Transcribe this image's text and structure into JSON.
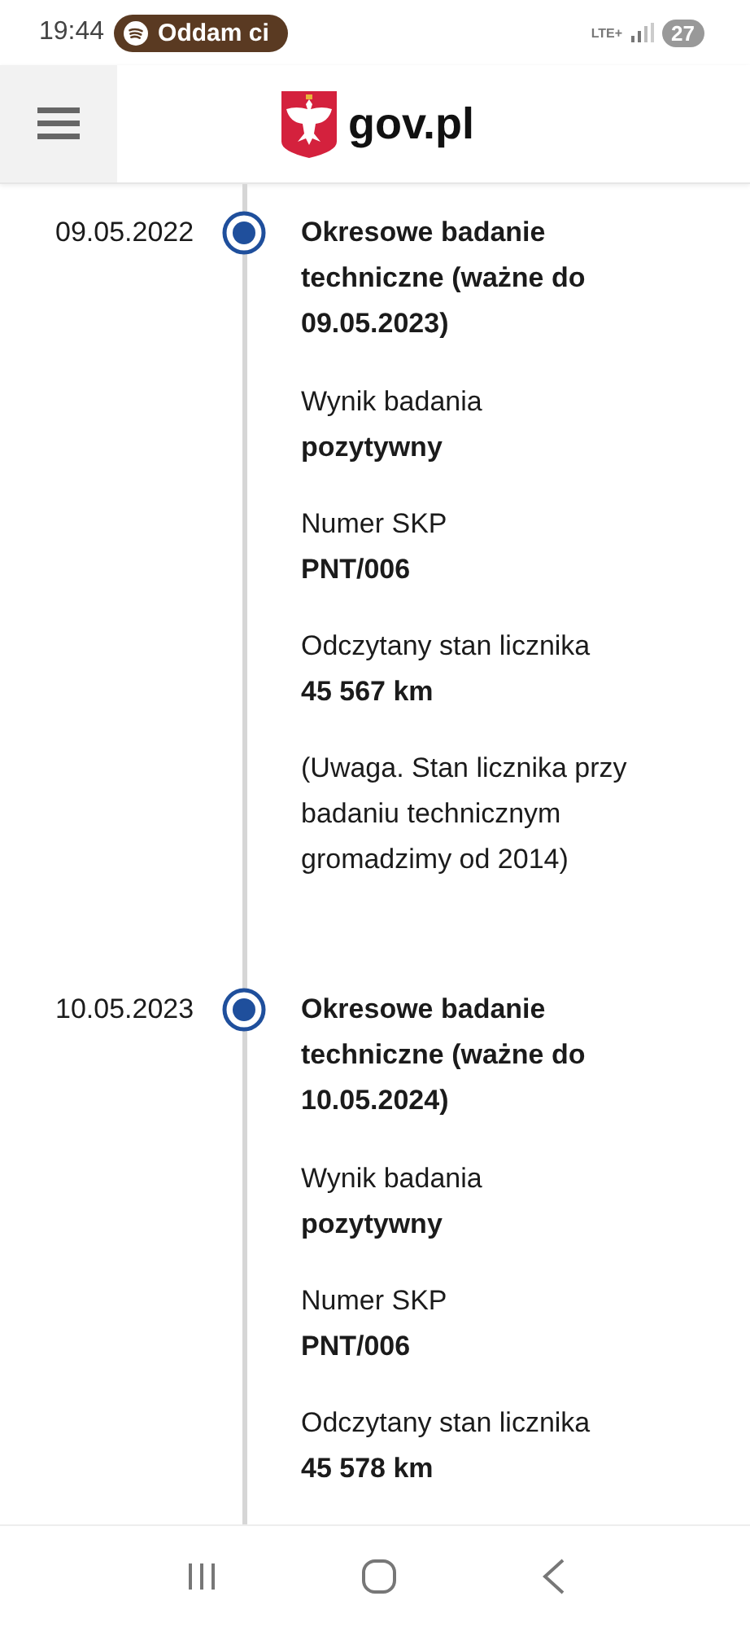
{
  "status_bar": {
    "time": "19:44",
    "media": "Oddam ci",
    "network": "LTE+",
    "battery": "27"
  },
  "header": {
    "logo_text": "gov.pl"
  },
  "timeline": [
    {
      "date": "09.05.2022",
      "title": "Okresowe badanie techniczne (ważne do 09.05.2023)",
      "fields": [
        {
          "label": "Wynik badania",
          "value": "pozytywny"
        },
        {
          "label": "Numer SKP",
          "value": "PNT/006"
        },
        {
          "label": "Odczytany stan licznika",
          "value": "45 567 km"
        }
      ],
      "note": "(Uwaga. Stan licznika przy badaniu technicznym gromadzimy od 2014)"
    },
    {
      "date": "10.05.2023",
      "title": "Okresowe badanie techniczne (ważne do 10.05.2024)",
      "fields": [
        {
          "label": "Wynik badania",
          "value": "pozytywny"
        },
        {
          "label": "Numer SKP",
          "value": "PNT/006"
        },
        {
          "label": "Odczytany stan licznika",
          "value": "45 578 km"
        }
      ]
    }
  ]
}
